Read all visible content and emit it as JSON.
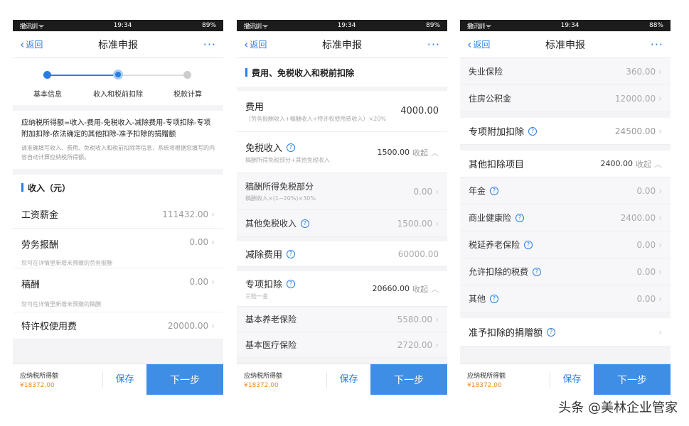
{
  "status": {
    "signal": "撒讯訓 ᯤ",
    "time": "19:34",
    "battery1": "89%",
    "battery2": "89%",
    "battery3": "88%"
  },
  "nav": {
    "back": "返回",
    "title": "标准申报",
    "more": "···"
  },
  "footer": {
    "tax_label": "应纳税所得额",
    "tax_value": "¥18372.00",
    "save": "保存",
    "next": "下一步"
  },
  "screen1": {
    "steps": [
      "基本信息",
      "收入和税前扣除",
      "税款计算"
    ],
    "formula": "应纳税所得额=收入-费用-免税收入-减除费用-专项扣除-专项附加扣除-依法确定的其他扣除-准予扣除的捐赠额",
    "note": "请准确填写收入、费用、免税收入和税前扣除等信息，系统将根据您填写的内容自动计算应纳税所得额。",
    "section": "收入（元）",
    "rows": [
      {
        "label": "工资薪金",
        "value": "111432.00",
        "hint": ""
      },
      {
        "label": "劳务报酬",
        "value": "0.00",
        "hint": "您可在详情里新增未预缴的劳务报酬"
      },
      {
        "label": "稿酬",
        "value": "0.00",
        "hint": "您可在详情里新增未预缴的稿酬"
      },
      {
        "label": "特许权使用费",
        "value": "20000.00",
        "hint": ""
      }
    ]
  },
  "screen2": {
    "section": "费用、免税收入和税前扣除",
    "fee": {
      "label": "费用",
      "hint": "（劳务报酬收入+稿酬收入+特许权使用费收入）×20%",
      "value": "4000.00"
    },
    "exempt": {
      "label": "免税收入",
      "hint": "稿酬所得免税部分+其他免税收入",
      "value": "1500.00",
      "toggle": "收起"
    },
    "exempt_sub": [
      {
        "label": "稿酬所得免税部分",
        "hint": "稿酬收入×(1−20%)×30%",
        "value": "0.00"
      },
      {
        "label": "其他免税收入",
        "hint": "",
        "value": "1500.00"
      }
    ],
    "deduct": {
      "label": "减除费用",
      "value": "60000.00"
    },
    "special": {
      "label": "专项扣除",
      "hint": "三险一金",
      "value": "20660.00",
      "toggle": "收起"
    },
    "special_sub": [
      {
        "label": "基本养老保险",
        "value": "5580.00"
      },
      {
        "label": "基本医疗保险",
        "value": "2720.00"
      }
    ]
  },
  "screen3": {
    "top_sub": [
      {
        "label": "失业保险",
        "value": "360.00"
      },
      {
        "label": "住房公积金",
        "value": "12000.00"
      }
    ],
    "extra": {
      "label": "专项附加扣除",
      "value": "24500.00"
    },
    "other": {
      "label": "其他扣除项目",
      "value": "2400.00",
      "toggle": "收起"
    },
    "other_sub": [
      {
        "label": "年金",
        "value": "0.00"
      },
      {
        "label": "商业健康险",
        "value": "2400.00"
      },
      {
        "label": "税延养老保险",
        "value": "0.00"
      },
      {
        "label": "允许扣除的税费",
        "value": "0.00"
      },
      {
        "label": "其他",
        "value": "0.00"
      }
    ],
    "donation": {
      "label": "准予扣除的捐赠额"
    }
  },
  "watermark": "头条 @美林企业管家"
}
